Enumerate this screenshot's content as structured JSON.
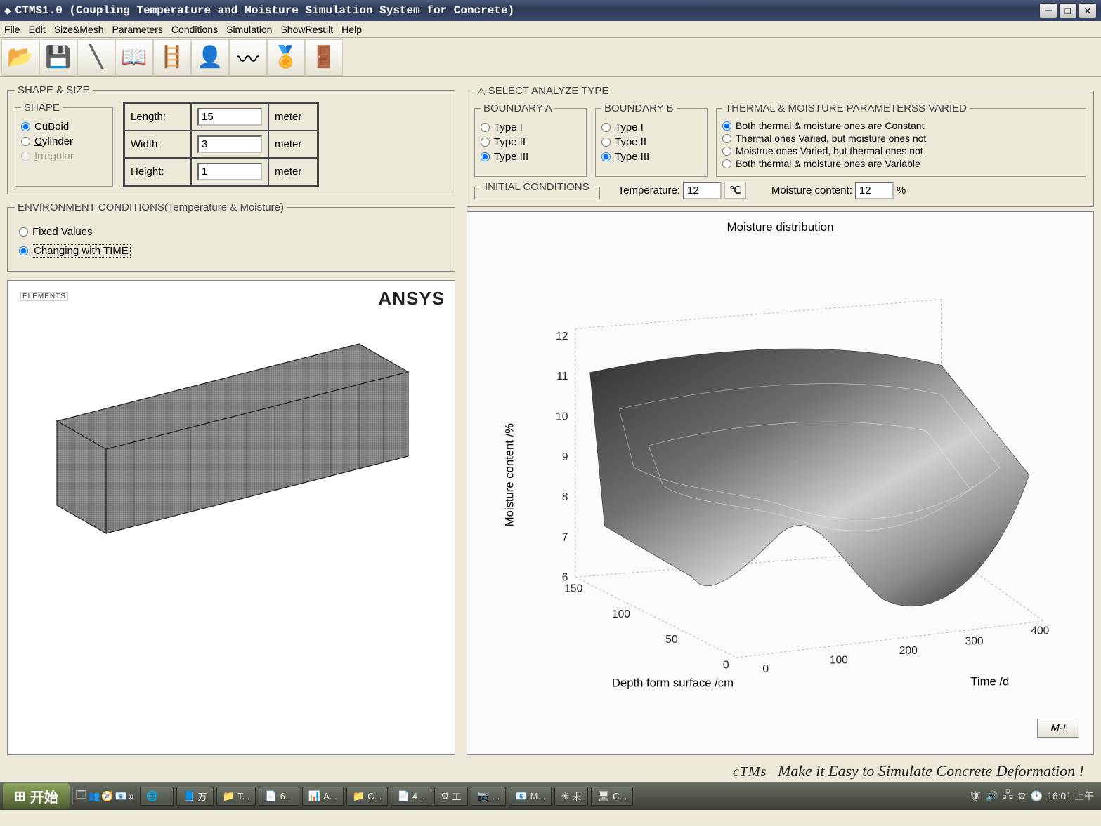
{
  "window": {
    "title": "CTMS1.0 (Coupling Temperature and Moisture Simulation System for Concrete)"
  },
  "menu": {
    "file": "File",
    "edit": "Edit",
    "sizemesh": "Size&Mesh",
    "parameters": "Parameters",
    "conditions": "Conditions",
    "simulation": "Simulation",
    "showresult": "ShowResult",
    "help": "Help"
  },
  "toolbar": {
    "icons": [
      "open-folder-icon",
      "save-icon",
      "slash-icon",
      "book-icon",
      "ladder-icon",
      "user-icon",
      "wave-icon",
      "medal-icon",
      "exit-icon"
    ]
  },
  "shape_size": {
    "legend": "SHAPE & SIZE",
    "shape_legend": "SHAPE",
    "options": {
      "cuboid": "CuBoid",
      "cylinder": "Cylinder",
      "irregular": "Irregular"
    },
    "dims": {
      "length_label": "Length:",
      "length_value": "15",
      "length_unit": "meter",
      "width_label": "Width:",
      "width_value": "3",
      "width_unit": "meter",
      "height_label": "Height:",
      "height_value": "1",
      "height_unit": "meter"
    }
  },
  "env": {
    "legend": "ENVIRONMENT CONDITIONS(Temperature & Moisture)",
    "fixed": "Fixed Values",
    "changing": "Changing with TIME"
  },
  "ansys": {
    "elements": "ELEMENTS",
    "logo": "ANSYS",
    "date": "",
    "time": ""
  },
  "analyze": {
    "legend": "△ SELECT ANALYZE TYPE",
    "boundA_legend": "BOUNDARY A",
    "boundB_legend": "BOUNDARY B",
    "type1": "Type I",
    "type2": "Type II",
    "type3": "Type III",
    "params_legend": "THERMAL & MOISTURE PARAMETERSS VARIED",
    "p1": "Both thermal & moisture ones are Constant",
    "p2": "Thermal ones Varied, but moisture ones not",
    "p3": "Moistrue ones Varied, but thermal ones not",
    "p4": "Both thermal & moisture ones are Variable",
    "initial_legend": "INITIAL CONDITIONS",
    "temp_label": "Temperature:",
    "temp_value": "12",
    "temp_unit": "℃",
    "moist_label": "Moisture content:",
    "moist_value": "12",
    "moist_unit": "%"
  },
  "plot": {
    "title": "Moisture distribution",
    "zlabel": "Moisture content /%",
    "xlabel": "Depth form surface /cm",
    "ylabel": "Time /d",
    "zticks": [
      "6",
      "7",
      "8",
      "9",
      "10",
      "11",
      "12"
    ],
    "xticks": [
      "0",
      "50",
      "100",
      "150"
    ],
    "yticks": [
      "0",
      "100",
      "200",
      "300",
      "400"
    ],
    "mt_btn": "M-t"
  },
  "slogan": {
    "brand": "cTMs",
    "text": "Make it Easy to Simulate Concrete Deformation !"
  },
  "taskbar": {
    "start": "开始",
    "items": [
      {
        "icon": "🌐",
        "label": ""
      },
      {
        "icon": "📘",
        "label": "万"
      },
      {
        "icon": "📁",
        "label": "T. ."
      },
      {
        "icon": "📄",
        "label": "6. ."
      },
      {
        "icon": "📊",
        "label": "A. ."
      },
      {
        "icon": "📁",
        "label": "C. ."
      },
      {
        "icon": "📄",
        "label": "4. ."
      },
      {
        "icon": "⚙",
        "label": "工"
      },
      {
        "icon": "📷",
        "label": ". ."
      },
      {
        "icon": "📧",
        "label": "M. ."
      },
      {
        "icon": "✳",
        "label": "未"
      },
      {
        "icon": "🖥",
        "label": "C. ."
      }
    ],
    "clock": "16:01 上午"
  },
  "chart_data": {
    "type": "surface3d",
    "title": "Moisture distribution",
    "x_axis": {
      "label": "Depth form surface /cm",
      "range": [
        0,
        150
      ],
      "ticks": [
        0,
        50,
        100,
        150
      ]
    },
    "y_axis": {
      "label": "Time /d",
      "range": [
        0,
        400
      ],
      "ticks": [
        0,
        100,
        200,
        300,
        400
      ]
    },
    "z_axis": {
      "label": "Moisture content /%",
      "range": [
        6,
        12
      ],
      "ticks": [
        6,
        7,
        8,
        9,
        10,
        11,
        12
      ]
    },
    "series": [
      {
        "name": "moisture_vs_depth_time",
        "x": [
          0,
          50,
          100,
          150
        ],
        "y": [
          0,
          100,
          200,
          300,
          400
        ],
        "z_grid": [
          [
            12.0,
            12.0,
            12.0,
            12.0
          ],
          [
            8.0,
            10.5,
            11.0,
            11.2
          ],
          [
            6.5,
            9.5,
            10.5,
            11.0
          ],
          [
            6.0,
            9.0,
            10.0,
            10.8
          ],
          [
            7.5,
            10.0,
            10.8,
            11.2
          ]
        ]
      }
    ]
  }
}
